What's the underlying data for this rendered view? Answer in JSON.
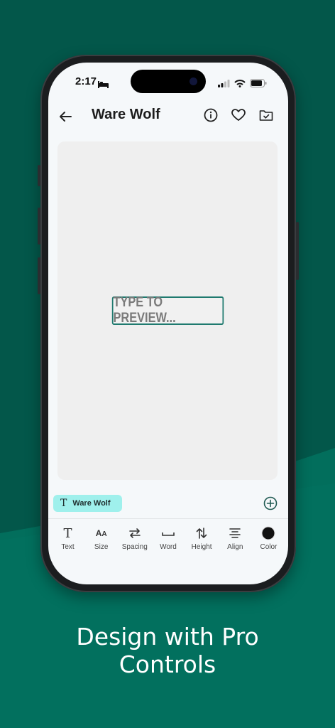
{
  "colors": {
    "background_top": "#03574a",
    "background_bottom": "#026e5c",
    "accent": "#1f7a6f",
    "chip_background": "#9ff0ec"
  },
  "status_bar": {
    "time": "2:17",
    "icons": [
      "bed-icon",
      "signal-icon",
      "wifi-icon",
      "battery-icon"
    ]
  },
  "header": {
    "title": "Ware Wolf",
    "icons": [
      "back-arrow-icon",
      "info-icon",
      "heart-icon",
      "folder-check-icon"
    ]
  },
  "preview": {
    "placeholder": "TYPE TO PREVIEW..."
  },
  "layer_chip": {
    "icon": "text-t-icon",
    "label": "Ware Wolf"
  },
  "add_layer": {
    "icon": "plus-circle-icon"
  },
  "toolbar": {
    "items": [
      {
        "label": "Text",
        "icon": "text-icon"
      },
      {
        "label": "Size",
        "icon": "font-size-icon"
      },
      {
        "label": "Spacing",
        "icon": "swap-arrows-icon"
      },
      {
        "label": "Word",
        "icon": "space-icon"
      },
      {
        "label": "Height",
        "icon": "up-down-arrows-icon"
      },
      {
        "label": "Align",
        "icon": "align-center-icon"
      },
      {
        "label": "Color",
        "icon": "color-dot-icon"
      }
    ]
  },
  "tagline": {
    "line1": "Design with Pro",
    "line2": "Controls"
  }
}
